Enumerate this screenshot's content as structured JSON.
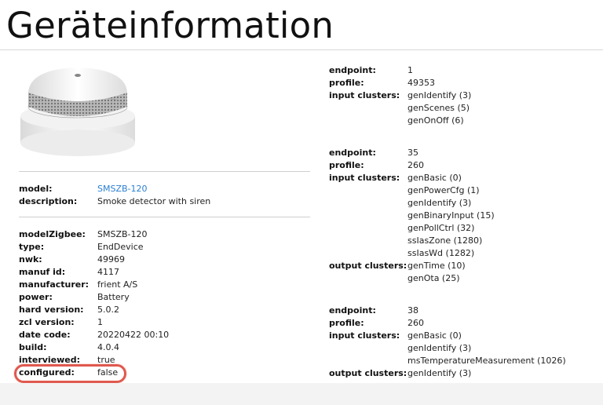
{
  "page": {
    "title": "Geräteinformation"
  },
  "device": {
    "model_label": "model:",
    "model_value": "SMSZB-120",
    "description_label": "description:",
    "description_value": "Smoke detector with siren"
  },
  "properties": [
    {
      "label": "modelZigbee:",
      "value": "SMSZB-120"
    },
    {
      "label": "type:",
      "value": "EndDevice"
    },
    {
      "label": "nwk:",
      "value": "49969"
    },
    {
      "label": "manuf id:",
      "value": "4117"
    },
    {
      "label": "manufacturer:",
      "value": "frient A/S"
    },
    {
      "label": "power:",
      "value": "Battery"
    },
    {
      "label": "hard version:",
      "value": "5.0.2"
    },
    {
      "label": "zcl version:",
      "value": "1"
    },
    {
      "label": "date code:",
      "value": "20220422 00:10"
    },
    {
      "label": "build:",
      "value": "4.0.4"
    },
    {
      "label": "interviewed:",
      "value": "true"
    },
    {
      "label": "configured:",
      "value": "false"
    }
  ],
  "endpoints": [
    {
      "endpoint_label": "endpoint:",
      "endpoint": "1",
      "profile_label": "profile:",
      "profile": "49353",
      "input_label": "input clusters:",
      "input_clusters": [
        "genIdentify (3)",
        "genScenes (5)",
        "genOnOff (6)"
      ]
    },
    {
      "endpoint_label": "endpoint:",
      "endpoint": "35",
      "profile_label": "profile:",
      "profile": "260",
      "input_label": "input clusters:",
      "input_clusters": [
        "genBasic (0)",
        "genPowerCfg (1)",
        "genIdentify (3)",
        "genBinaryInput (15)",
        "genPollCtrl (32)",
        "ssIasZone (1280)",
        "ssIasWd (1282)"
      ],
      "output_label": "output clusters:",
      "output_clusters": [
        "genTime (10)",
        "genOta (25)"
      ]
    },
    {
      "endpoint_label": "endpoint:",
      "endpoint": "38",
      "profile_label": "profile:",
      "profile": "260",
      "input_label": "input clusters:",
      "input_clusters": [
        "genBasic (0)",
        "genIdentify (3)",
        "msTemperatureMeasurement (1026)"
      ],
      "output_label": "output clusters:",
      "output_clusters": [
        "genIdentify (3)"
      ]
    }
  ],
  "colors": {
    "link": "#2a7fd1",
    "highlight": "#e0584e"
  }
}
